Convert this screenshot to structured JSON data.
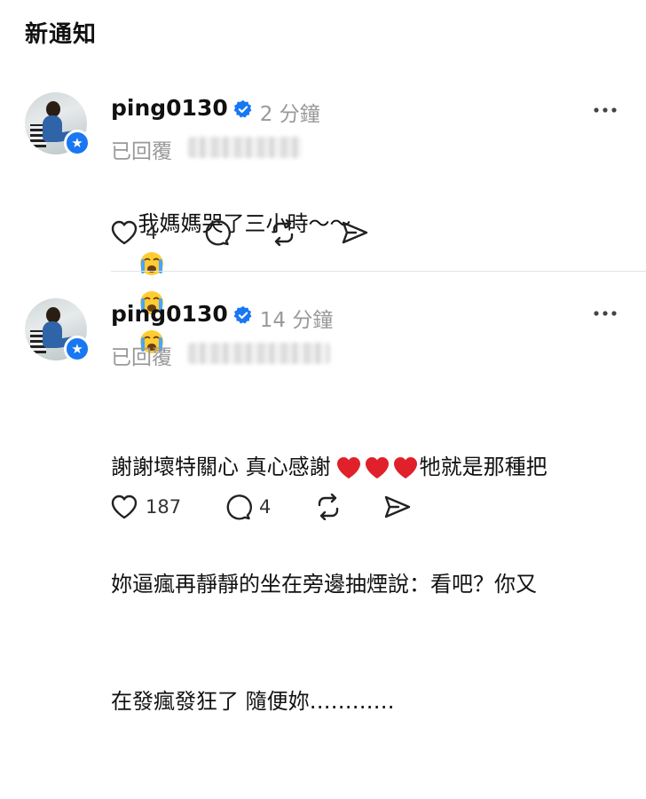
{
  "page": {
    "title": "新通知"
  },
  "notifications": [
    {
      "username": "ping0130",
      "time": "2 分鐘",
      "reply_label": "已回覆",
      "text": "我媽媽哭了三小時～～",
      "emojis": [
        "crying-face",
        "crying-face",
        "crying-face"
      ],
      "likes": "4",
      "replies": "",
      "icons": [
        "heart-icon",
        "comment-icon",
        "repost-icon",
        "share-icon",
        "more-icon",
        "verified-icon"
      ]
    },
    {
      "username": "ping0130",
      "time": "14 分鐘",
      "reply_label": "已回覆",
      "text_line1_a": "謝謝壞特關心 真心感謝",
      "hearts": [
        "red-heart",
        "red-heart",
        "red-heart"
      ],
      "text_line1_b": "牠就是那種把",
      "text_line2": "妳逼瘋再靜靜的坐在旁邊抽煙說：看吧？你又",
      "text_line3": "在發瘋發狂了 隨便妳…………",
      "likes": "187",
      "replies": "4"
    }
  ],
  "colors": {
    "verified": "#1877f2",
    "muted": "#999999",
    "divider": "#e2e2e2"
  }
}
